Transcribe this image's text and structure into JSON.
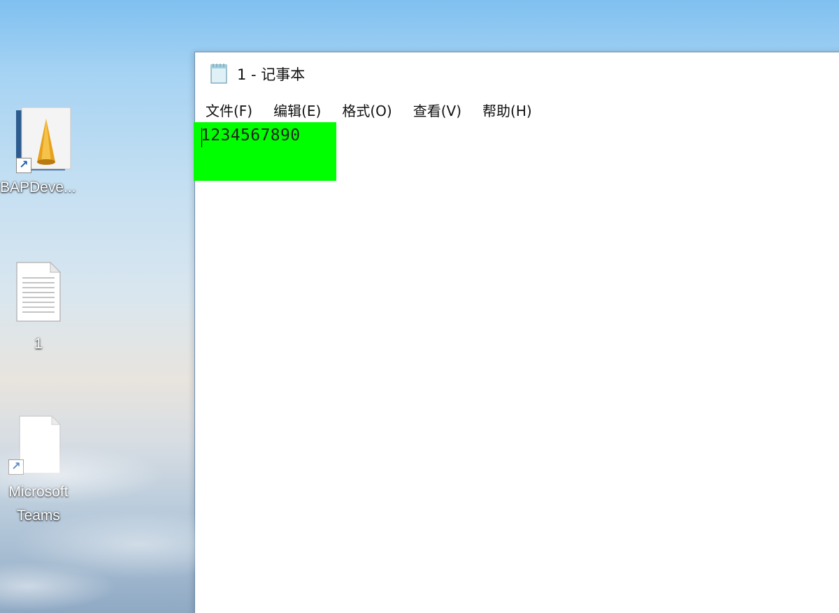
{
  "desktop": {
    "icons": [
      {
        "label": "BAPDeve...",
        "icon": "abap-development-icon",
        "shortcut": true
      },
      {
        "label": "1",
        "icon": "text-document-icon",
        "shortcut": false
      },
      {
        "label": "Microsoft Teams",
        "icon": "blank-document-icon",
        "shortcut": true
      }
    ]
  },
  "notepad": {
    "title": "1 - 记事本",
    "menu": [
      "文件(F)",
      "编辑(E)",
      "格式(O)",
      "查看(V)",
      "帮助(H)"
    ],
    "content": "1234567890",
    "highlight_color": "#00ff00"
  }
}
